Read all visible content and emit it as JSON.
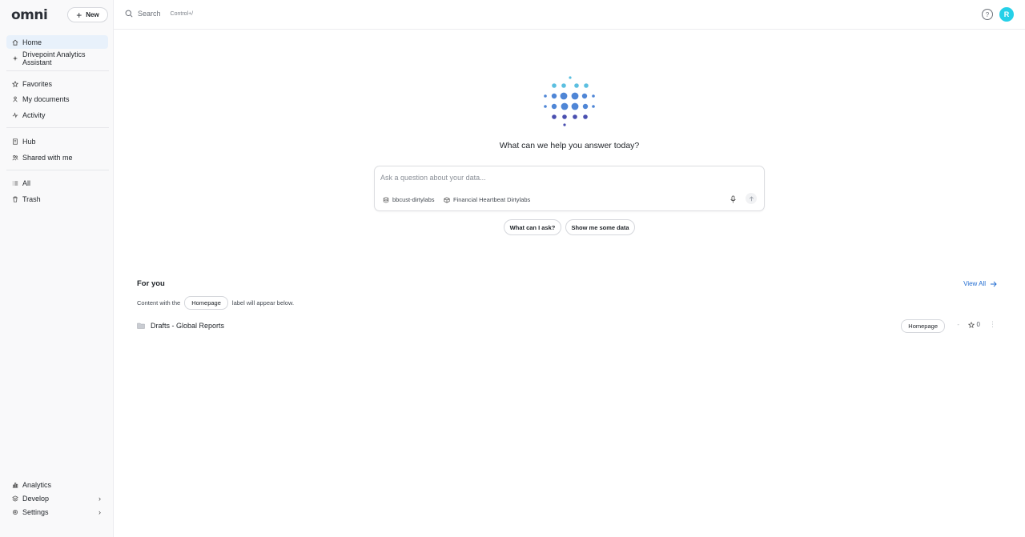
{
  "app": {
    "logo": "omni",
    "new_label": "New"
  },
  "colors": {
    "accent": "#25d0e8",
    "active_bg": "#e8f1fb",
    "link": "#1f6bd1",
    "dot_light": "#5bbfe0",
    "dot_mid": "#4f86d6",
    "dot_dark": "#4a4fb0"
  },
  "sidebar": {
    "top": [
      {
        "label": "Home",
        "icon": "home-icon",
        "active": true
      },
      {
        "label": "Drivepoint Analytics Assistant",
        "icon": "sparkle-icon"
      }
    ],
    "personal": [
      {
        "label": "Favorites",
        "icon": "star-icon"
      },
      {
        "label": "My documents",
        "icon": "person-icon"
      },
      {
        "label": "Activity",
        "icon": "activity-icon"
      }
    ],
    "shared": [
      {
        "label": "Hub",
        "icon": "book-icon"
      },
      {
        "label": "Shared with me",
        "icon": "users-icon"
      }
    ],
    "misc": [
      {
        "label": "All",
        "icon": "list-icon"
      },
      {
        "label": "Trash",
        "icon": "trash-icon"
      }
    ],
    "bottom": [
      {
        "label": "Analytics",
        "icon": "analytics-icon"
      },
      {
        "label": "Develop",
        "icon": "develop-icon",
        "chevron": "›"
      },
      {
        "label": "Settings",
        "icon": "gear-icon",
        "chevron": "›"
      }
    ]
  },
  "topbar": {
    "search_label": "Search",
    "shortcut": "Control+/",
    "help": "?",
    "avatar_initial": "R"
  },
  "assistant": {
    "prompt": "What can we help you answer today?",
    "placeholder": "Ask a question about your data...",
    "connection": "bbcust-dirtylabs",
    "model": "Financial Heartbeat Dirtylabs",
    "suggestions": [
      "What can I ask?",
      "Show me some data"
    ]
  },
  "for_you": {
    "title": "For you",
    "view_all": "View All",
    "note_before": "Content with the",
    "note_tag": "Homepage",
    "note_after": "label will appear below.",
    "items": [
      {
        "name": "Drafts - Global Reports",
        "tag": "Homepage",
        "updated": "-",
        "favorites": "0"
      }
    ]
  }
}
